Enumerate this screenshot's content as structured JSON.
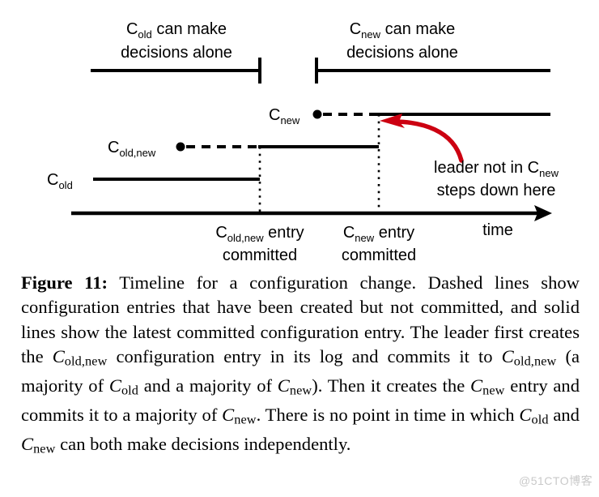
{
  "figure": {
    "diagram": {
      "top_brackets": [
        {
          "id": "cold-bracket",
          "text_line1_base": "C",
          "text_line1_sub": "old",
          "text_line1_rest": " can make",
          "text_line2": "decisions alone"
        },
        {
          "id": "cnew-bracket",
          "text_line1_base": "C",
          "text_line1_sub": "new",
          "text_line1_rest": " can make",
          "text_line2": "decisions alone"
        }
      ],
      "series_labels": {
        "cnew": {
          "base": "C",
          "sub": "new"
        },
        "coldnew": {
          "base": "C",
          "sub": "old,new"
        },
        "cold": {
          "base": "C",
          "sub": "old"
        }
      },
      "annotation": {
        "line1_pre": "leader not in ",
        "line1_base": "C",
        "line1_sub": "new",
        "line2": "steps down here",
        "color": "#CC0011"
      },
      "axis": {
        "label": "time"
      },
      "event_labels": [
        {
          "base": "C",
          "sub": "old,new",
          "rest": " entry",
          "line2": "committed"
        },
        {
          "base": "C",
          "sub": "new",
          "rest": " entry",
          "line2": "committed"
        }
      ]
    },
    "caption": {
      "figure_number": "Figure 11:",
      "part1": " Timeline for a configuration change. Dashed lines show configuration entries that have been created but not committed, and solid lines show the latest committed configuration entry. The leader first creates the ",
      "var1_base": "C",
      "var1_sub": "old,new",
      "part2": " configuration entry in its log and commits it to ",
      "var2_base": "C",
      "var2_sub": "old,new",
      "part3": " (a majority of ",
      "var3_base": "C",
      "var3_sub": "old",
      "part4": " and a majority of ",
      "var4_base": "C",
      "var4_sub": "new",
      "part5": "). Then it creates the ",
      "var5_base": "C",
      "var5_sub": "new",
      "part6": " entry and commits it to a majority of ",
      "var6_base": "C",
      "var6_sub": "new",
      "part7": ". There is no point in time in which ",
      "var7_base": "C",
      "var7_sub": "old",
      "part8": " and ",
      "var8_base": "C",
      "var8_sub": "new",
      "part9": " can both make decisions independently."
    },
    "watermark": "@51CTO博客"
  }
}
